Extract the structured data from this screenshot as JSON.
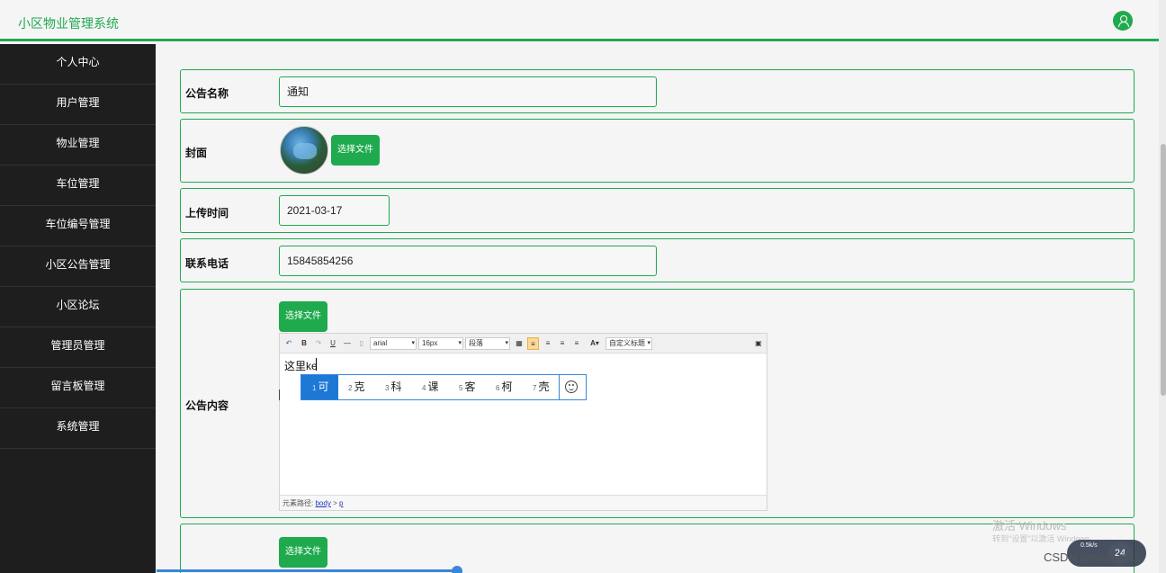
{
  "app": {
    "title": "小区物业管理系统"
  },
  "sidebar": {
    "items": [
      {
        "label": "个人中心"
      },
      {
        "label": "用户管理"
      },
      {
        "label": "物业管理"
      },
      {
        "label": "车位管理"
      },
      {
        "label": "车位编号管理"
      },
      {
        "label": "小区公告管理"
      },
      {
        "label": "小区论坛"
      },
      {
        "label": "管理员管理"
      },
      {
        "label": "留言板管理"
      },
      {
        "label": "系统管理"
      }
    ]
  },
  "form": {
    "name_label": "公告名称",
    "name_value": "通知",
    "cover_label": "封面",
    "select_file": "选择文件",
    "upload_time_label": "上传时间",
    "upload_time_value": "2021-03-17",
    "phone_label": "联系电话",
    "phone_value": "15845854256",
    "content_label": "公告内容"
  },
  "editor": {
    "font_family": "arial",
    "font_size": "16px",
    "paragraph": "段落",
    "custom_title": "自定义标题",
    "text": "这里ke",
    "path_label": "元素路径:",
    "path_body": "body",
    "path_sep": ">",
    "path_p": "p"
  },
  "ime": {
    "candidates": [
      {
        "num": "1",
        "char": "可"
      },
      {
        "num": "2",
        "char": "克"
      },
      {
        "num": "3",
        "char": "科"
      },
      {
        "num": "4",
        "char": "课"
      },
      {
        "num": "5",
        "char": "客"
      },
      {
        "num": "6",
        "char": "柯"
      },
      {
        "num": "7",
        "char": "壳"
      }
    ]
  },
  "overlay": {
    "watermark_line1": "激活 Windows",
    "watermark_line2": "转到\"设置\"以激活 Windows",
    "net_speed": "0.5k/s",
    "net_number": "24",
    "csdn": "CSDN @sheji1011"
  }
}
